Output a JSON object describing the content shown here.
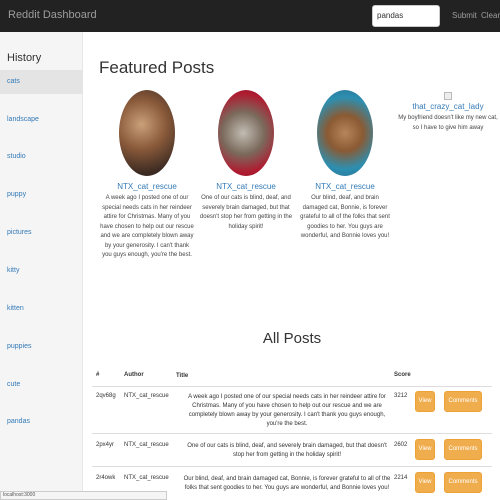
{
  "navbar": {
    "brand": "Reddit Dashboard",
    "search_value": "pandas",
    "submit_label": "Submit",
    "clear_label": "Clear"
  },
  "sidebar": {
    "title": "History",
    "items": [
      "cats",
      "landscape",
      "studio",
      "puppy",
      "pictures",
      "kitty",
      "kitten",
      "puppies",
      "cute",
      "pandas"
    ],
    "active": "cats"
  },
  "featured": {
    "title": "Featured Posts",
    "posts": [
      {
        "author": "NTX_cat_rescue",
        "text": "A week ago I posted one of our special needs cats in her reindeer attire for Christmas. Many of you have chosen to help out our rescue and we are completely blown away by your generosity. I can't thank you guys enough, you're the best."
      },
      {
        "author": "NTX_cat_rescue",
        "text": "One of our cats is blind, deaf, and severely brain damaged, but that doesn't stop her from getting in the holiday spirit!"
      },
      {
        "author": "NTX_cat_rescue",
        "text": "Our blind, deaf, and brain damaged cat, Bonnie, is forever grateful to all of the folks that sent goodies to her. You guys are wonderful, and Bonnie loves you!"
      },
      {
        "author": "that_crazy_cat_lady",
        "text": "My boyfriend doesn't like my new cat, so I have to give him away"
      }
    ]
  },
  "all_posts": {
    "title": "All Posts",
    "columns": [
      "#",
      "Author",
      "Title",
      "Score"
    ],
    "view_label": "View",
    "comments_label": "Comments",
    "rows": [
      {
        "id": "2qv68g",
        "author": "NTX_cat_rescue",
        "title": "A week ago I posted one of our special needs cats in her reindeer attire for Christmas. Many of you have chosen to help out our rescue and we are completely blown away by your generosity. I can't thank you guys enough, you're the best.",
        "score": "3212"
      },
      {
        "id": "2px4yr",
        "author": "NTX_cat_rescue",
        "title": "One of our cats is blind, deaf, and severely brain damaged, but that doesn't stop her from getting in the holiday spirit!",
        "score": "2602"
      },
      {
        "id": "2r4owk",
        "author": "NTX_cat_rescue",
        "title": "Our blind, deaf, and brain damaged cat, Bonnie, is forever grateful to all of the folks that sent goodies to her. You guys are wonderful, and Bonnie loves you!",
        "score": "2214"
      }
    ]
  },
  "status_bar": {
    "text": "localhost:3000"
  },
  "colors": {
    "navbar_bg": "#222222",
    "link": "#337ab7",
    "button_warning": "#f0ad4e"
  }
}
